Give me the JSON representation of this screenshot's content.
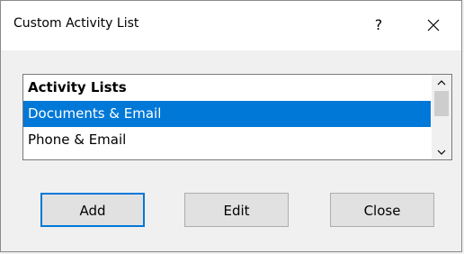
{
  "window": {
    "title": "Custom Activity List",
    "help_label": "?",
    "close_icon": "close-icon"
  },
  "list": {
    "header": "Activity Lists",
    "items": [
      {
        "label": "Documents & Email",
        "selected": true
      },
      {
        "label": "Phone & Email",
        "selected": false
      }
    ]
  },
  "buttons": {
    "add": "Add",
    "edit": "Edit",
    "close": "Close"
  },
  "colors": {
    "selection": "#0078d7",
    "button_face": "#e1e1e1",
    "dialog_bg": "#f0f0f0"
  }
}
